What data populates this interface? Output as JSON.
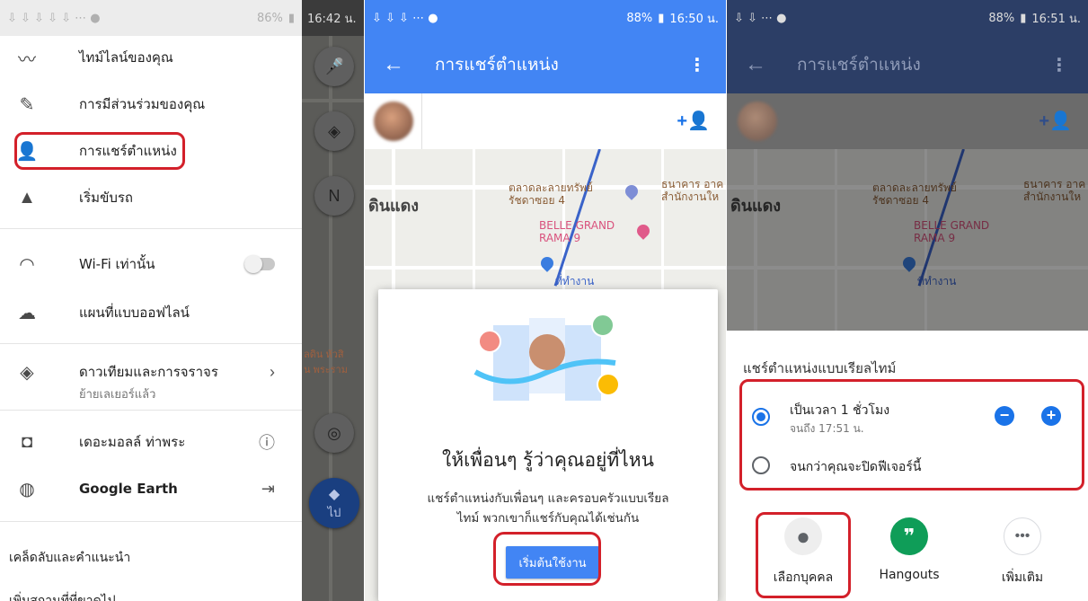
{
  "panel1": {
    "status_time": "16:42 น.",
    "status_battery": "86%",
    "menu": [
      {
        "icon": "timeline-icon",
        "label": "ไทม์ไลน์ของคุณ"
      },
      {
        "icon": "contributions-icon",
        "label": "การมีส่วนร่วมของคุณ"
      },
      {
        "icon": "location-sharing-icon",
        "label": "การแชร์ตำแหน่ง"
      },
      {
        "icon": "navigation-icon",
        "label": "เริ่มขับรถ"
      },
      {
        "icon": "wifi-icon",
        "label": "Wi-Fi เท่านั้น"
      },
      {
        "icon": "offline-cloud-icon",
        "label": "แผนที่แบบออฟไลน์"
      },
      {
        "icon": "layers-icon",
        "label": "ดาวเทียมและการจราจร",
        "sub": "ย้ายเลเยอร์แล้ว"
      },
      {
        "icon": "place-icon",
        "label": "เดอะมอลล์ ท่าพระ"
      },
      {
        "icon": "earth-icon",
        "label": "Google Earth"
      }
    ],
    "tips": "เคล็ดลับและคำแนะนำ",
    "bottom_cut": "เพิ่มสถานที่ที่ขาดไป",
    "map_go": "ไป",
    "map_text_1": "ลดิน หัวสิ",
    "map_text_2": "น พระราม"
  },
  "panel2": {
    "status_time": "16:50 น.",
    "status_battery": "88%",
    "title": "การแชร์ตำแหน่ง",
    "district": "ดินแดง",
    "poi1": "ตลาดละลายทรัพย์\nรัชดาซอย 4",
    "poi2": "ธนาคาร อาค\nสำนักงานให",
    "poi3": "BELLE GRAND\nRAMA 9",
    "poi4": "ที่ทำงาน",
    "dialog_title": "ให้เพื่อนๆ รู้ว่าคุณอยู่ที่ไหน",
    "dialog_body_1": "แชร์ตำแหน่งกับเพื่อนๆ และครอบครัวแบบเรียล",
    "dialog_body_2": "ไทม์ พวกเขาก็แชร์กับคุณได้เช่นกัน",
    "dialog_button": "เริ่มต้นใช้งาน"
  },
  "panel3": {
    "status_time": "16:51 น.",
    "status_battery": "88%",
    "title": "การแชร์ตำแหน่ง",
    "district": "ดินแดง",
    "poi1": "ตลาดละลายทรัพย์\nรัชดาซอย 4",
    "poi2": "ธนาคาร อาค\nสำนักงานให",
    "poi3": "BELLE GRAND\nRAMA 9",
    "poi4": "ที่ทำงาน",
    "sheet_title": "แชร์ตำแหน่งแบบเรียลไทม์",
    "option1_label": "เป็นเวลา 1 ชั่วโมง",
    "option1_sub": "จนถึง 17:51 น.",
    "option2_label": "จนกว่าคุณจะปิดฟีเจอร์นี้",
    "targets": [
      "เลือกบุคคล",
      "Hangouts",
      "เพิ่มเติม"
    ]
  },
  "colors": {
    "accent": "#4285f4",
    "highlight": "#d3202a",
    "hangouts": "#0f9d58"
  }
}
